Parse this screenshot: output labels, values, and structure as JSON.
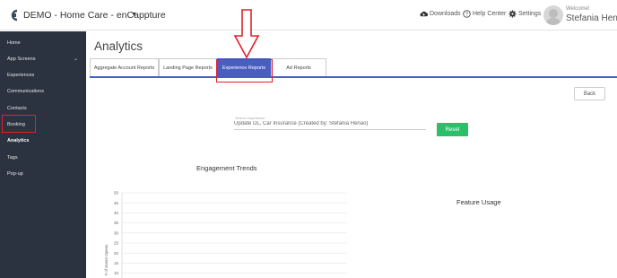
{
  "header": {
    "app_title": "DEMO - Home Care - enCappture",
    "downloads_label": "Downloads",
    "help_label": "Help Center",
    "settings_label": "Settings",
    "welcome_label": "Welcome!",
    "user_name": "Stefania Henao"
  },
  "sidebar": {
    "items": [
      {
        "label": "Home"
      },
      {
        "label": "App Screens"
      },
      {
        "label": "Experiences"
      },
      {
        "label": "Communications"
      },
      {
        "label": "Contacts"
      },
      {
        "label": "Booking"
      },
      {
        "label": "Analytics"
      },
      {
        "label": "Tags"
      },
      {
        "label": "Pop-up"
      }
    ],
    "active": "Analytics"
  },
  "main": {
    "page_title": "Analytics",
    "tabs": [
      {
        "label": "Aggregate Account Reports"
      },
      {
        "label": "Landing Page Reports"
      },
      {
        "label": "Experience Reports"
      },
      {
        "label": "Ad Reports"
      }
    ],
    "active_tab": "Experience Reports",
    "back_label": "Back",
    "search": {
      "label": "Search experience",
      "value": "Update DL, Car Insurance (Created by: Stefania Henao)"
    },
    "reset_label": "Reset",
    "engagement_title": "Engagement Trends",
    "feature_title": "Feature Usage"
  },
  "colors": {
    "accent": "#4a5ec1",
    "sidebar_bg": "#2b3340",
    "reset_green": "#2cbf6a",
    "highlight_red": "#e0202a"
  },
  "chart_data": {
    "type": "line",
    "title": "Engagement Trends",
    "ylabel": "# of Event Opens",
    "xlabel": "",
    "ylim": [
      10,
      50
    ],
    "yticks": [
      "50",
      "45",
      "40",
      "35",
      "30",
      "25",
      "20",
      "15",
      "10"
    ],
    "grid": true,
    "series": []
  }
}
